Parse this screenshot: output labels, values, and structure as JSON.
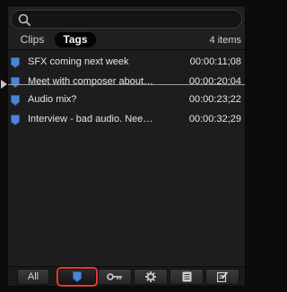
{
  "search": {
    "value": "",
    "placeholder": ""
  },
  "tabs": [
    {
      "label": "Clips",
      "active": false
    },
    {
      "label": "Tags",
      "active": true
    }
  ],
  "item_count": "4 items",
  "tags": [
    {
      "name": "SFX coming next week",
      "timecode": "00:00:11;08",
      "icon": "marker-icon"
    },
    {
      "name": "Meet with composer about…",
      "timecode": "00:00:20;04",
      "icon": "marker-icon"
    },
    {
      "name": "Audio mix?",
      "timecode": "00:00:23;22",
      "icon": "marker-icon"
    },
    {
      "name": "Interview - bad audio. Nee…",
      "timecode": "00:00:32;29",
      "icon": "marker-icon"
    }
  ],
  "toolbar": {
    "all_label": "All",
    "buttons": [
      "markers-icon",
      "keyword-icon",
      "gear-icon",
      "notes-icon",
      "todo-icon"
    ]
  },
  "colors": {
    "marker_blue": "#4a86d8",
    "highlight_red": "#e33a34"
  }
}
